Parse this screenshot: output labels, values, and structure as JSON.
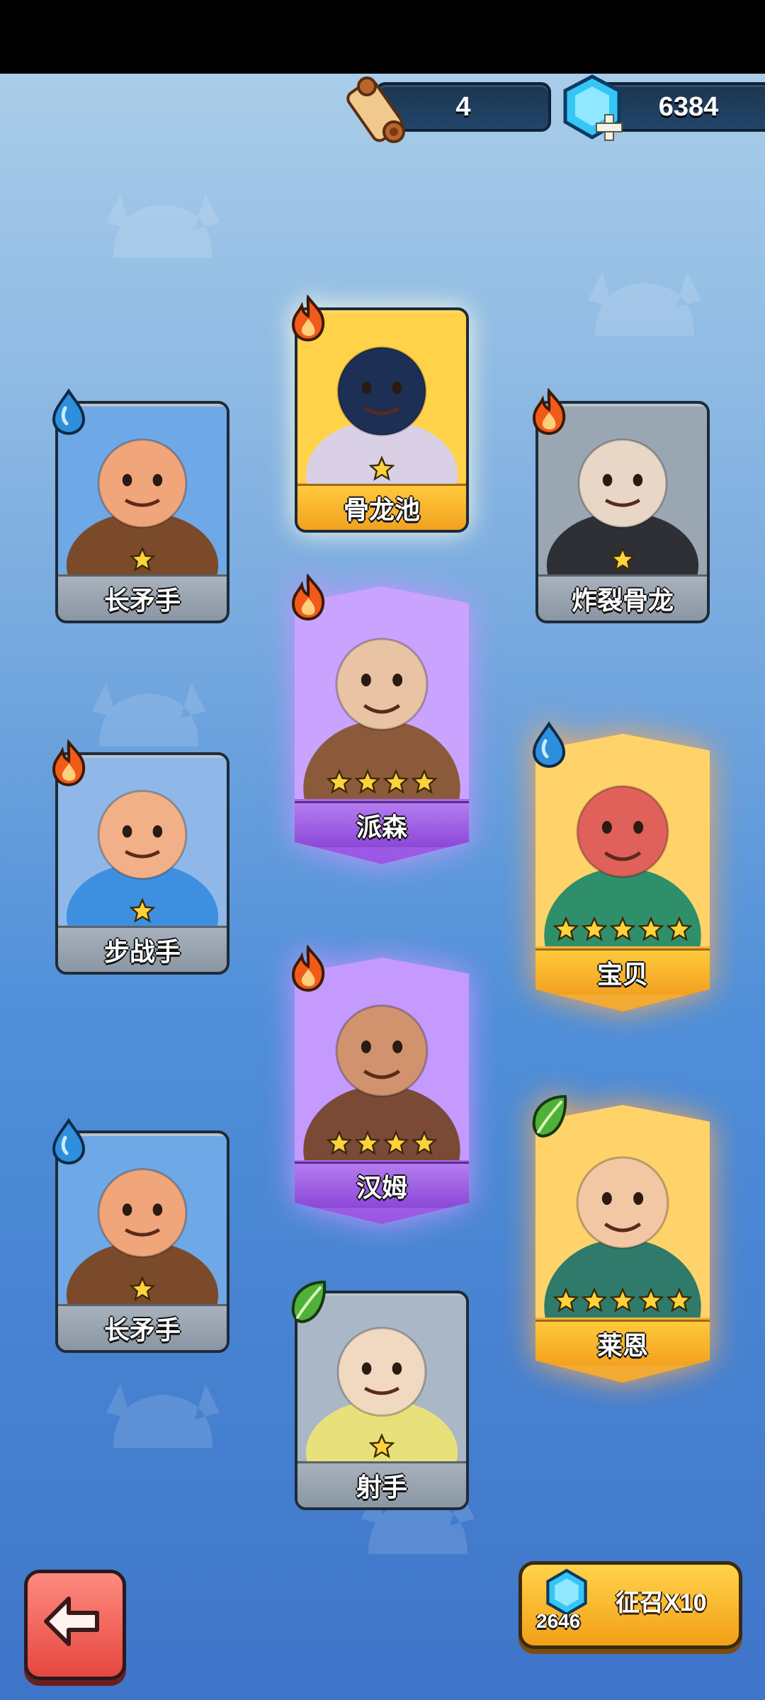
{
  "currency": {
    "scrolls": "4",
    "gems": "6384"
  },
  "colors": {
    "fire": "#f25a1a",
    "water": "#2e8fdc",
    "leaf": "#4fb13a",
    "star": "#ffd23a"
  },
  "cards": [
    {
      "id": "spearman-1",
      "name": "长矛手",
      "rarity": "common",
      "element": "water",
      "stars": 1
    },
    {
      "id": "bone-dragon-pool",
      "name": "骨龙池",
      "rarity": "gold",
      "element": "fire",
      "stars": 1
    },
    {
      "id": "exploding-bone-dragon",
      "name": "炸裂骨龙",
      "rarity": "common",
      "element": "fire",
      "stars": 1
    },
    {
      "id": "paisen",
      "name": "派森",
      "rarity": "purple",
      "element": "fire",
      "stars": 4
    },
    {
      "id": "footman",
      "name": "步战手",
      "rarity": "common",
      "element": "fire",
      "stars": 1
    },
    {
      "id": "baobei",
      "name": "宝贝",
      "rarity": "gold",
      "element": "water",
      "stars": 5
    },
    {
      "id": "hanmu",
      "name": "汉姆",
      "rarity": "purple",
      "element": "fire",
      "stars": 4
    },
    {
      "id": "spearman-2",
      "name": "长矛手",
      "rarity": "common",
      "element": "water",
      "stars": 1
    },
    {
      "id": "laien",
      "name": "莱恩",
      "rarity": "gold",
      "element": "leaf",
      "stars": 5
    },
    {
      "id": "archer",
      "name": "射手",
      "rarity": "common",
      "element": "leaf",
      "stars": 1
    }
  ],
  "summon": {
    "label": "征召X10",
    "cost": "2646"
  },
  "icons": {
    "back": "back-arrow-icon",
    "scroll": "scroll-icon",
    "gem": "gem-plus-icon"
  }
}
